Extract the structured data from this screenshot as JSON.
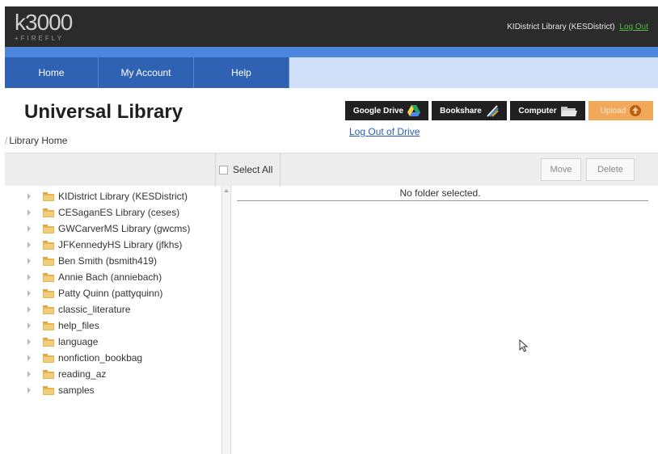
{
  "header": {
    "logo_main": "k3000",
    "logo_sub": "+FIREFLY",
    "user_label": "KIDistrict Library (KESDistrict)",
    "logout_label": "Log Out"
  },
  "nav": {
    "tabs": [
      {
        "label": "Home"
      },
      {
        "label": "My Account"
      },
      {
        "label": "Help"
      }
    ]
  },
  "page": {
    "title": "Universal Library",
    "breadcrumb": "Library Home"
  },
  "services": {
    "google_drive": "Google Drive",
    "bookshare": "Bookshare",
    "computer": "Computer",
    "upload": "Upload",
    "drive_logout": "Log Out of Drive"
  },
  "toolbar": {
    "select_all": "Select All",
    "move": "Move",
    "delete": "Delete"
  },
  "tree": {
    "items": [
      {
        "label": "KIDistrict Library (KESDistrict)"
      },
      {
        "label": "CESaganES Library (ceses)"
      },
      {
        "label": "GWCarverMS Library (gwcms)"
      },
      {
        "label": "JFKennedyHS Library (jfkhs)"
      },
      {
        "label": "Ben Smith (bsmith419)"
      },
      {
        "label": "Annie Bach (anniebach)"
      },
      {
        "label": "Patty Quinn (pattyquinn)"
      },
      {
        "label": "classic_literature"
      },
      {
        "label": "help_files"
      },
      {
        "label": "language"
      },
      {
        "label": "nonfiction_bookbag"
      },
      {
        "label": "reading_az"
      },
      {
        "label": "samples"
      }
    ]
  },
  "content": {
    "empty_message": "No folder selected."
  },
  "colors": {
    "header_bg": "#2b2b2b",
    "nav_tab": "#2f62b3",
    "accent_band": "#4d86dd",
    "upload_btn": "#f2a85a",
    "logout_green": "#4fbf3a",
    "link_blue": "#2a5bb8"
  },
  "icons": {
    "google_drive": "google-drive-icon",
    "bookshare": "bookshare-icon",
    "computer": "folder-open-icon",
    "upload": "upload-arrow-icon",
    "tree_folder": "folder-icon",
    "tree_expand": "chevron-right-icon"
  }
}
